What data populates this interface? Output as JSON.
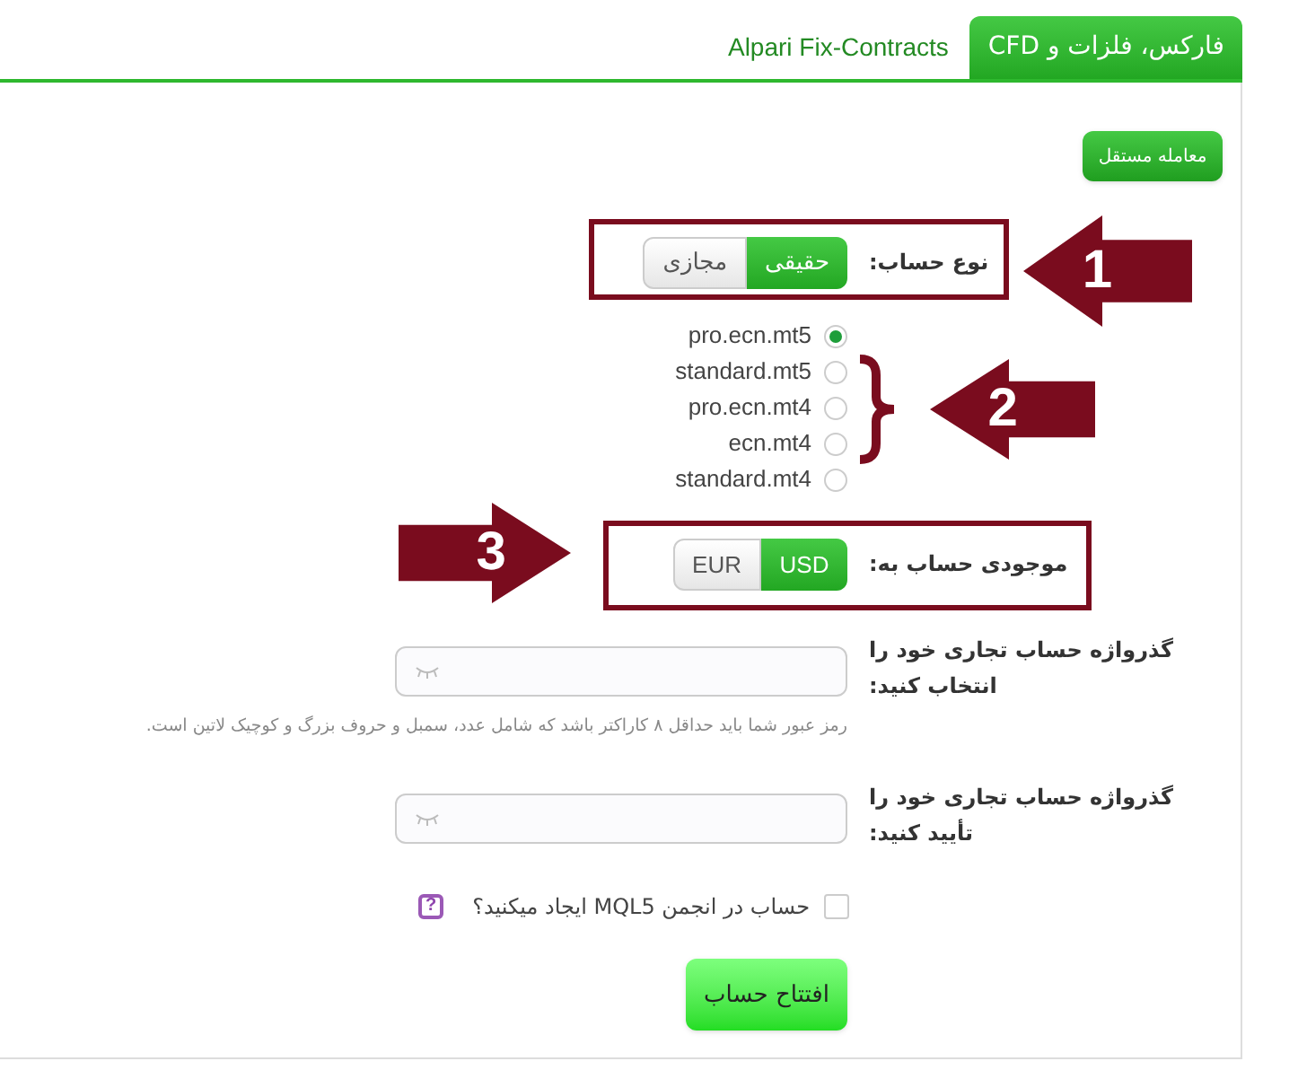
{
  "tabs": [
    {
      "label": "فارکس، فلزات و CFD",
      "selected": true
    },
    {
      "label": "Alpari Fix-Contracts",
      "selected": false
    }
  ],
  "independent_trading_button": "معامله مستقل",
  "account_type": {
    "label": "نوع حساب:",
    "options": [
      {
        "label": "حقیقی",
        "selected": true
      },
      {
        "label": "مجازی",
        "selected": false
      }
    ]
  },
  "servers": [
    {
      "label": "pro.ecn.mt5",
      "selected": true
    },
    {
      "label": "standard.mt5",
      "selected": false
    },
    {
      "label": "pro.ecn.mt4",
      "selected": false
    },
    {
      "label": "ecn.mt4",
      "selected": false
    },
    {
      "label": "standard.mt4",
      "selected": false
    }
  ],
  "currency": {
    "label": "موجودی حساب به:",
    "options": [
      {
        "label": "USD",
        "selected": true
      },
      {
        "label": "EUR",
        "selected": false
      }
    ]
  },
  "password": {
    "label": "گذرواژه حساب تجاری خود را انتخاب کنید:",
    "hint": "رمز عبور شما باید حداقل ۸ کاراکتر باشد که شامل عدد، سمبل و حروف بزرگ و کوچیک لاتین است."
  },
  "confirm_password": {
    "label": "گذرواژه حساب تجاری خود را تأیید کنید:"
  },
  "mql5": {
    "label": "حساب در انجمن MQL5 ایجاد میکنید؟",
    "checked": false,
    "help": "?"
  },
  "submit": "افتتاح حساب",
  "annotations": [
    {
      "number": "1"
    },
    {
      "number": "2"
    },
    {
      "number": "3"
    }
  ]
}
